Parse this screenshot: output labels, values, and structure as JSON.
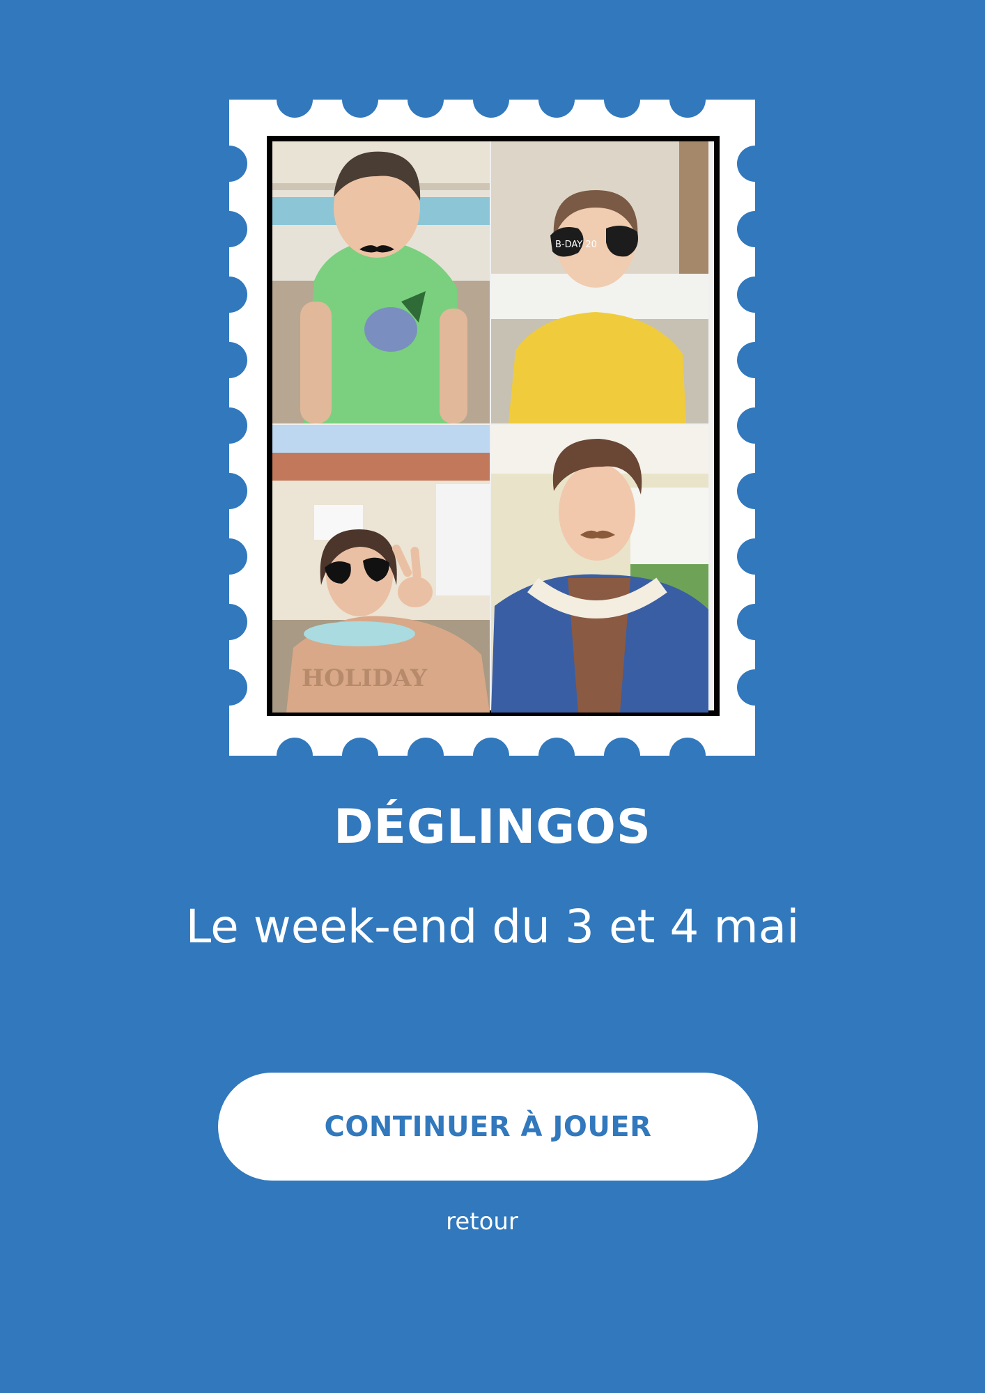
{
  "page": {
    "background_color": "#3178bd",
    "accent_color": "#3178bd"
  },
  "stamp": {
    "photos": [
      {
        "subject": "boy-green-tshirt-mustache"
      },
      {
        "subject": "girl-yellow-dress-heart-glasses"
      },
      {
        "subject": "girl-holiday-sweater-peace-sign"
      },
      {
        "subject": "boy-hawaiian-shirt-mustache"
      }
    ],
    "glasses_text": "B-DAY 20",
    "sweater_text": "HOLIDAY"
  },
  "title": "DÉGLINGOS",
  "subtitle": "Le week-end du 3 et 4 mai",
  "continue_button": "CONTINUER À JOUER",
  "back_link": "retour"
}
